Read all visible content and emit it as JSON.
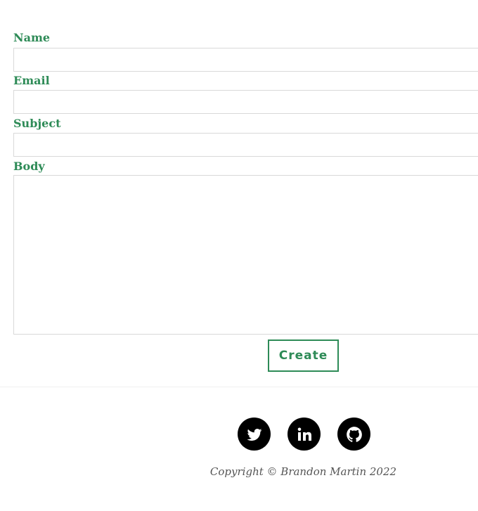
{
  "form": {
    "name_label": "Name",
    "name_value": "",
    "email_label": "Email",
    "email_value": "",
    "subject_label": "Subject",
    "subject_value": "",
    "body_label": "Body",
    "body_value": "",
    "submit_label": "Create"
  },
  "footer": {
    "social": [
      {
        "icon": "twitter-icon"
      },
      {
        "icon": "linkedin-icon"
      },
      {
        "icon": "github-icon"
      }
    ],
    "copyright": "Copyright © Brandon Martin 2022"
  },
  "colors": {
    "accent": "#2e8b57",
    "social_bg": "#000000",
    "input_border": "#d9d9d9"
  }
}
